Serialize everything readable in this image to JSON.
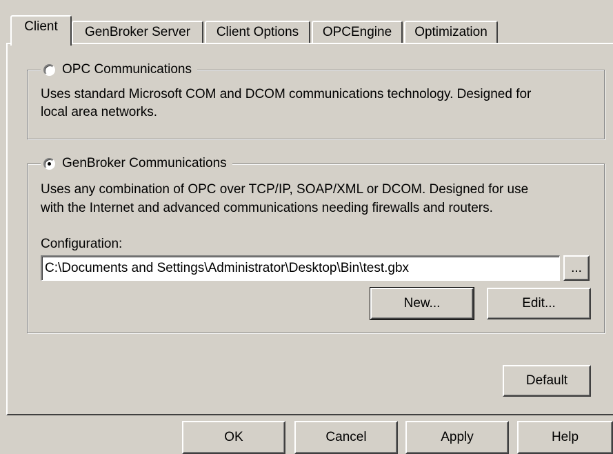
{
  "tabs": [
    "Client",
    "GenBroker Server",
    "Client Options",
    "OPCEngine",
    "Optimization"
  ],
  "opc_group": {
    "label": "OPC Communications",
    "selected": false,
    "description_line1": "Uses standard Microsoft COM and DCOM communications technology. Designed for",
    "description_line2": "local area networks."
  },
  "genbroker_group": {
    "label": "GenBroker Communications",
    "selected": true,
    "description_line1": "Uses any combination of OPC over TCP/IP, SOAP/XML or DCOM. Designed for use",
    "description_line2": "with the Internet and advanced communications needing firewalls and routers.",
    "config_label": "Configuration:",
    "config_value": "C:\\Documents and Settings\\Administrator\\Desktop\\Bin\\test.gbx",
    "browse_label": "...",
    "new_label": "New...",
    "edit_label": "Edit..."
  },
  "default_label": "Default",
  "footer": {
    "ok_label": "OK",
    "cancel_label": "Cancel",
    "apply_label": "Apply",
    "help_label": "Help"
  }
}
